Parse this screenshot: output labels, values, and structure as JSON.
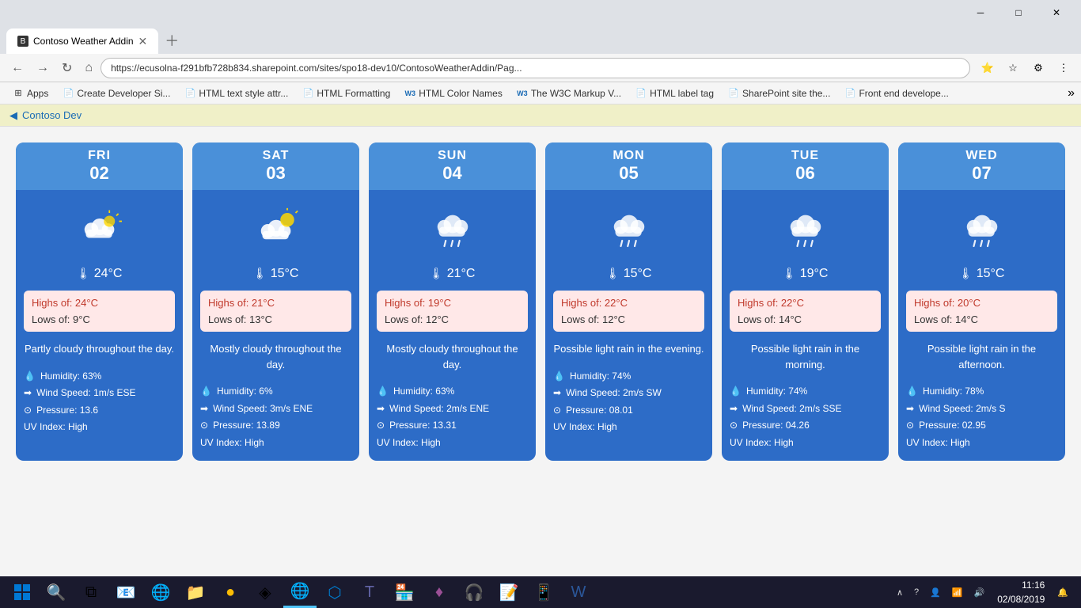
{
  "browser": {
    "tab_label": "Contoso Weather Addin",
    "address": "https://ecusolna-f291bfb728b834.sharepoint.com/sites/spo18-dev10/ContosoWeatherAddin/Pag...",
    "win_minimize": "─",
    "win_maximize": "□",
    "win_close": "✕"
  },
  "bookmarks": [
    {
      "id": "apps",
      "label": "Apps",
      "icon": "⊞"
    },
    {
      "id": "create-dev",
      "label": "Create Developer Si...",
      "icon": "📄"
    },
    {
      "id": "html-text",
      "label": "HTML text style attr...",
      "icon": "📄"
    },
    {
      "id": "html-format",
      "label": "HTML Formatting",
      "icon": "📄"
    },
    {
      "id": "html-color",
      "label": "HTML Color Names",
      "icon": "W3"
    },
    {
      "id": "w3c",
      "label": "The W3C Markup V...",
      "icon": "W3"
    },
    {
      "id": "html-label",
      "label": "HTML label tag",
      "icon": "📄"
    },
    {
      "id": "sharepoint",
      "label": "SharePoint site the...",
      "icon": "📄"
    },
    {
      "id": "frontend",
      "label": "Front end develope...",
      "icon": "📄"
    }
  ],
  "sp_banner": {
    "link_text": "Contoso Dev"
  },
  "days": [
    {
      "day": "FRI",
      "date": "02",
      "weather_icon": "⛅",
      "temperature": "24°C",
      "highs": "Highs of: 24°C",
      "lows": "Lows of: 9°C",
      "description": "Partly cloudy throughout the day.",
      "humidity": "Humidity: 63%",
      "wind_speed": "Wind Speed: 1m/s ESE",
      "pressure": "Pressure: 13.6",
      "uv": "UV Index: High"
    },
    {
      "day": "SAT",
      "date": "03",
      "weather_icon": "🌤",
      "temperature": "15°C",
      "highs": "Highs of: 21°C",
      "lows": "Lows of: 13°C",
      "description": "Mostly cloudy throughout the day.",
      "humidity": "Humidity: 6%",
      "wind_speed": "Wind Speed: 3m/s ENE",
      "pressure": "Pressure: 13.89",
      "uv": "UV Index: High"
    },
    {
      "day": "SUN",
      "date": "04",
      "weather_icon": "🌧",
      "temperature": "21°C",
      "highs": "Highs of: 19°C",
      "lows": "Lows of: 12°C",
      "description": "Mostly cloudy throughout the day.",
      "humidity": "Humidity: 63%",
      "wind_speed": "Wind Speed: 2m/s ENE",
      "pressure": "Pressure: 13.31",
      "uv": "UV Index: High"
    },
    {
      "day": "MON",
      "date": "05",
      "weather_icon": "🌧",
      "temperature": "15°C",
      "highs": "Highs of: 22°C",
      "lows": "Lows of: 12°C",
      "description": "Possible light rain in the evening.",
      "humidity": "Humidity: 74%",
      "wind_speed": "Wind Speed: 2m/s SW",
      "pressure": "Pressure: 08.01",
      "uv": "UV Index: High"
    },
    {
      "day": "TUE",
      "date": "06",
      "weather_icon": "🌧",
      "temperature": "19°C",
      "highs": "Highs of: 22°C",
      "lows": "Lows of: 14°C",
      "description": "Possible light rain in the morning.",
      "humidity": "Humidity: 74%",
      "wind_speed": "Wind Speed: 2m/s SSE",
      "pressure": "Pressure: 04.26",
      "uv": "UV Index: High"
    },
    {
      "day": "WED",
      "date": "07",
      "weather_icon": "🌧",
      "temperature": "15°C",
      "highs": "Highs of: 20°C",
      "lows": "Lows of: 14°C",
      "description": "Possible light rain in the afternoon.",
      "humidity": "Humidity: 78%",
      "wind_speed": "Wind Speed: 2m/s S",
      "pressure": "Pressure: 02.95",
      "uv": "UV Index: High"
    }
  ],
  "taskbar": {
    "clock_time": "11:16",
    "clock_date": "02/08/2019"
  }
}
